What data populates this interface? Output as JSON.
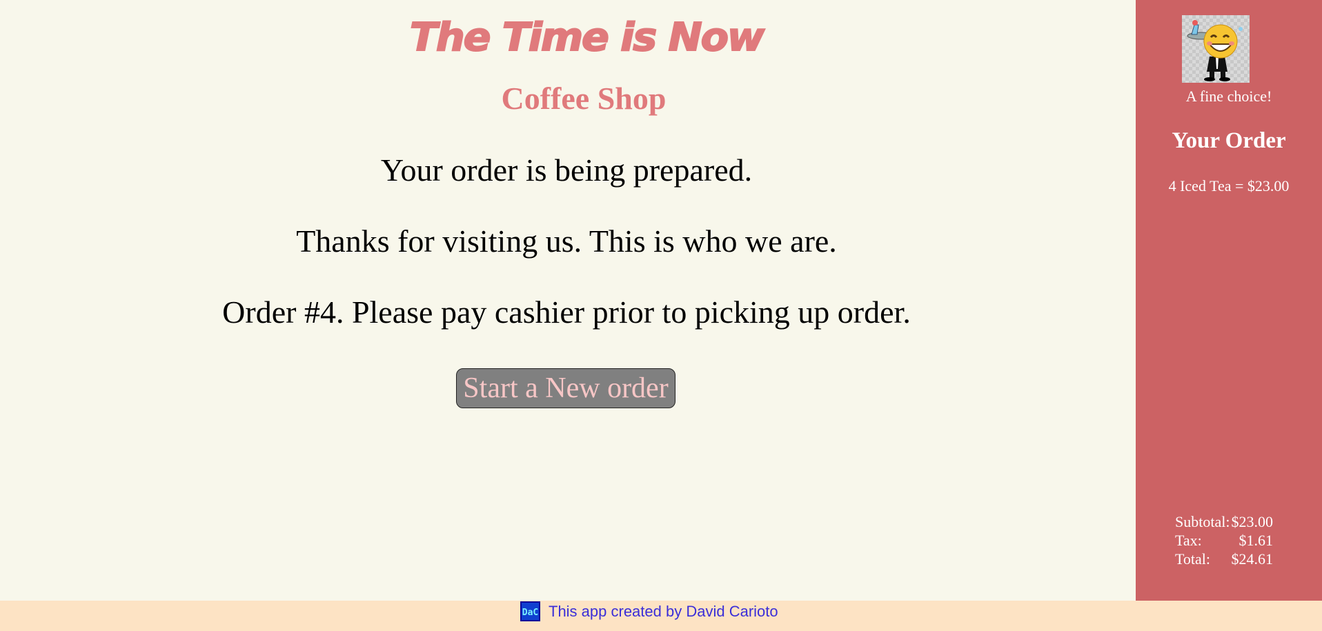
{
  "brand": {
    "title": "The Time is Now",
    "subtitle": "Coffee Shop"
  },
  "main": {
    "message_1": "Your order is being prepared.",
    "message_2": "Thanks for visiting us. This is who we are.",
    "message_3": "Order #4. Please pay cashier prior to picking up order.",
    "new_order_button": "Start a New order"
  },
  "sidebar": {
    "avatar_icon": "waiter-emoji-icon",
    "tagline": "A fine choice!",
    "order_heading": "Your Order",
    "order_line": "4 Iced Tea = $23.00",
    "totals": [
      {
        "label": "Subtotal:",
        "value": "$23.00"
      },
      {
        "label": "Tax:",
        "value": "$1.61"
      },
      {
        "label": "Total:",
        "value": "$24.61"
      }
    ]
  },
  "footer": {
    "logo_icon": "dac-logo-icon",
    "logo_text": "DaC",
    "text": "This app created by David Carioto"
  },
  "colors": {
    "background": "#f8f7eb",
    "accent": "#e07a7c",
    "sidebar": "#cc6264",
    "footer": "#fde3c4",
    "footer_text": "#3b2fd8",
    "button": "#808080"
  }
}
